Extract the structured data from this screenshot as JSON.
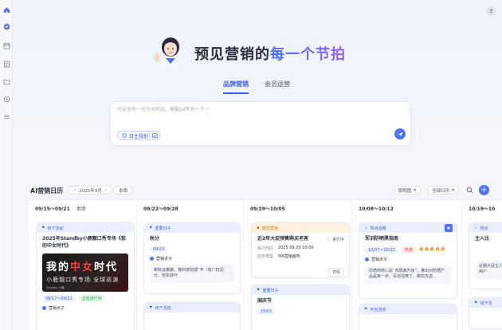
{
  "sidebar": {
    "items": [
      {
        "name": "home-icon",
        "active": true
      },
      {
        "name": "plus-circle-icon"
      },
      {
        "name": "calendar-icon"
      },
      {
        "name": "document-icon"
      },
      {
        "name": "folder-icon"
      },
      {
        "name": "settings-icon"
      },
      {
        "name": "list-icon"
      }
    ]
  },
  "hero": {
    "title_dark": "预见营销的",
    "title_grad": "每一个节拍"
  },
  "tabs": [
    {
      "label": "品牌营销",
      "active": true
    },
    {
      "label": "会员运营",
      "active": false
    }
  ],
  "prompt": {
    "placeholder": "为这里有一句引导的话。需要pd帮我一下一",
    "chip_label": "日主规划",
    "send_icon": "send-icon",
    "image_icon": "image-icon"
  },
  "calendar": {
    "title": "AI营销日历",
    "month": "2025年9月",
    "this_week": "本周",
    "view": "周视图",
    "date_filter": "全部日历",
    "add": "+",
    "columns": [
      {
        "range": "09/15～09/21",
        "sub": "本周"
      },
      {
        "range": "09/22～09/28",
        "sub": ""
      },
      {
        "range": "09/29～10/05",
        "sub": ""
      },
      {
        "range": "10/08～10/12",
        "sub": ""
      },
      {
        "range": "10/19～10",
        "sub": ""
      }
    ],
    "cards": {
      "c1": {
        "tag": "线下活动",
        "title": "2025年Standby小鹿靓口秀专场《我的中女时代》",
        "poster_line1a": "我的",
        "poster_line1b": "中女",
        "poster_line1c": "时代",
        "poster_line2": "小鹿靓口秀专场 全球巡演",
        "poster_brand": "Standby 小鹿",
        "date": "08/17～09/21",
        "status": "正在进行中",
        "author": "营销贞子"
      },
      "c2": {
        "tag": "重要日子",
        "title": "秋分",
        "date": "09/23",
        "author": "营销贞子",
        "desc": "耕秋运粮期，猫科技助理“丰（收）”技调分，轻松获升"
      },
      "c2b": {
        "tag": "线下活动"
      },
      "c3": {
        "tag": "概念营销",
        "title": "近2年大促预售购买老客",
        "status": "进行中",
        "k1": "执行时间",
        "v1": "2025.09.30 10:00",
        "k2": "任务类型",
        "v2": "MA营销画布",
        "detail": "详情"
      },
      "c3b": {
        "tag": "重要日子",
        "title": "国庆节",
        "date": "10/01"
      },
      "c4": {
        "tag": "热点话题",
        "title": "军训防晒黑指南",
        "date": "10/07～10/12",
        "hot": "热度",
        "flames": "🔥🔥🔥🔥🔥",
        "author": "营销贞子",
        "desc": "防晒档核心是“双隔离升级”，推出对防晒产品是第一步，军训活寒了，霸优先选…"
      },
      "c4b": {
        "tag": "平台活动"
      },
      "c5": {
        "tag": "热点",
        "title": "主人比",
        "desc": "近期大促主人好的用户"
      },
      "c5b": {
        "tag": "线下活"
      }
    }
  },
  "colors": {
    "accent": "#4f73f7",
    "tag_blue_bg": "#e9efff",
    "tag_orange_bg": "#fff1de"
  }
}
